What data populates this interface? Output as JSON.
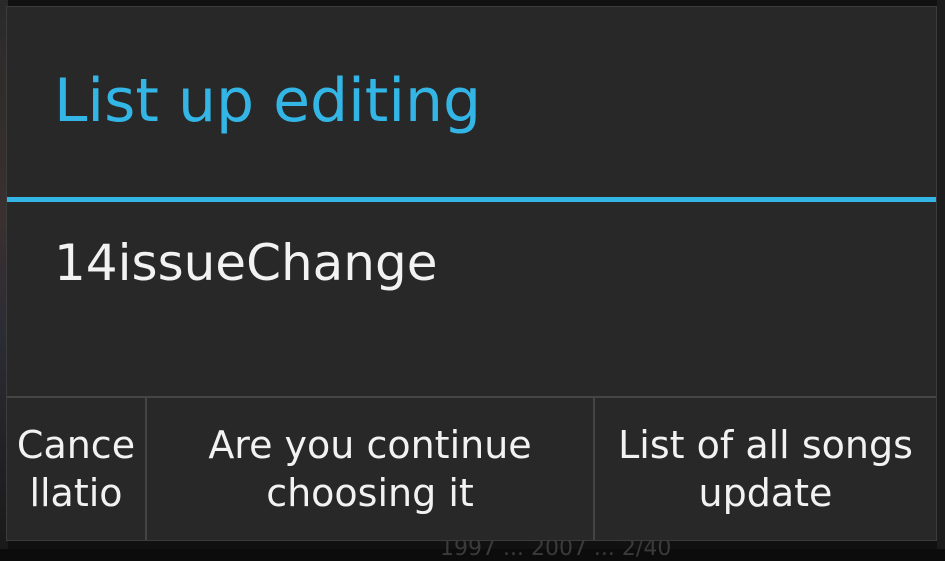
{
  "background": {
    "partial_text": "1997 ... 2007 ... 2/40"
  },
  "dialog": {
    "title": "List up editing",
    "message": "14issueChange",
    "accent_color": "#33b5e5",
    "buttons": {
      "cancel": {
        "line1": "Cance",
        "line2": "llatio"
      },
      "continue": {
        "line1": "Are you continue",
        "line2": "choosing it"
      },
      "update": {
        "line1": "List of all songs",
        "line2": "update"
      }
    }
  }
}
